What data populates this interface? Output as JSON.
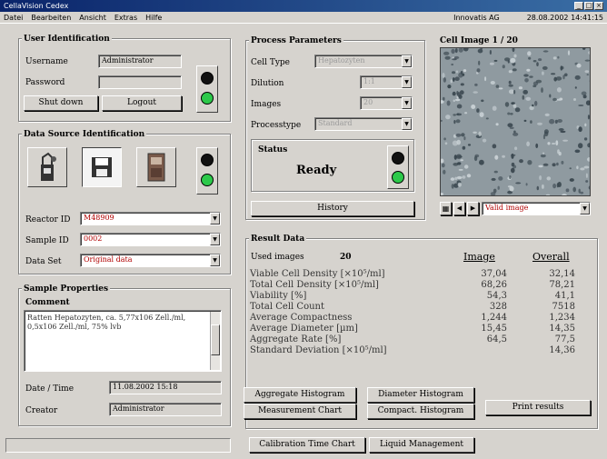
{
  "window": {
    "title": "CellaVision Cedex"
  },
  "menu": {
    "items": [
      "Datei",
      "Bearbeiten",
      "Ansicht",
      "Extras",
      "Hilfe"
    ],
    "right": [
      "Innovatis AG",
      "28.08.2002 14:41:15"
    ]
  },
  "user_identification": {
    "title": "User Identification",
    "username_label": "Username",
    "username_value": "Administrator",
    "password_label": "Password",
    "password_value": "",
    "shut_down_label": "Shut down",
    "logout_label": "Logout"
  },
  "data_source": {
    "title": "Data Source Identification",
    "reactor_label": "Reactor ID",
    "reactor_value": "M48909",
    "sample_label": "Sample ID",
    "sample_value": "0002",
    "dataset_label": "Data Set",
    "dataset_value": "Original data"
  },
  "sample_properties": {
    "title": "Sample Properties",
    "comment_label": "Comment",
    "comment_value": "Ratten Hepatozyten, ca. 5,77x106 Zell./ml, 0,5x106 Zell./ml, 75% lvb",
    "datetime_label": "Date / Time",
    "datetime_value": "11.08.2002 15:18",
    "creator_label": "Creator",
    "creator_value": "Administrator"
  },
  "process_parameters": {
    "title": "Process Parameters",
    "celltype_label": "Cell Type",
    "celltype_value": "Hepatozyten",
    "dilution_label": "Dilution",
    "dilution_value": "1:1",
    "images_label": "Images",
    "images_value": "20",
    "processtype_label": "Processtype",
    "processtype_value": "Standard",
    "status_label": "Status",
    "status_value": "Ready",
    "history_label": "History"
  },
  "cell_image": {
    "title": "Cell Image 1 / 20",
    "view_value": "Valid image"
  },
  "result_data": {
    "title": "Result Data",
    "used_images_label": "Used images",
    "used_images_value": "20",
    "col_image": "Image",
    "col_overall": "Overall",
    "rows": [
      {
        "label": "Viable Cell Density [×10⁵/ml]",
        "image": "37,04",
        "overall": "32,14"
      },
      {
        "label": "Total Cell Density [×10⁵/ml]",
        "image": "68,26",
        "overall": "78,21"
      },
      {
        "label": "Viability [%]",
        "image": "54,3",
        "overall": "41,1"
      },
      {
        "label": "Total Cell Count",
        "image": "328",
        "overall": "7518"
      },
      {
        "label": "Average Compactness",
        "image": "1,244",
        "overall": "1,234"
      },
      {
        "label": "Average Diameter [µm]",
        "image": "15,45",
        "overall": "14,35"
      },
      {
        "label": "Aggregate Rate [%]",
        "image": "64,5",
        "overall": "77,5"
      },
      {
        "label": "Standard Deviation [×10⁵/ml]",
        "image": "",
        "overall": "14,36"
      }
    ],
    "aggregate_histogram_label": "Aggregate Histogram",
    "diameter_histogram_label": "Diameter Histogram",
    "measurement_chart_label": "Measurement Chart",
    "compact_histogram_label": "Compact. Histogram",
    "print_results_label": "Print results"
  },
  "bottom": {
    "calibration_label": "Calibration Time Chart",
    "liquid_management_label": "Liquid Management"
  },
  "colors": {
    "lamp_green": "#2cc94a",
    "titlebar": "#0a246a",
    "window_bg": "#d6d3ce"
  }
}
